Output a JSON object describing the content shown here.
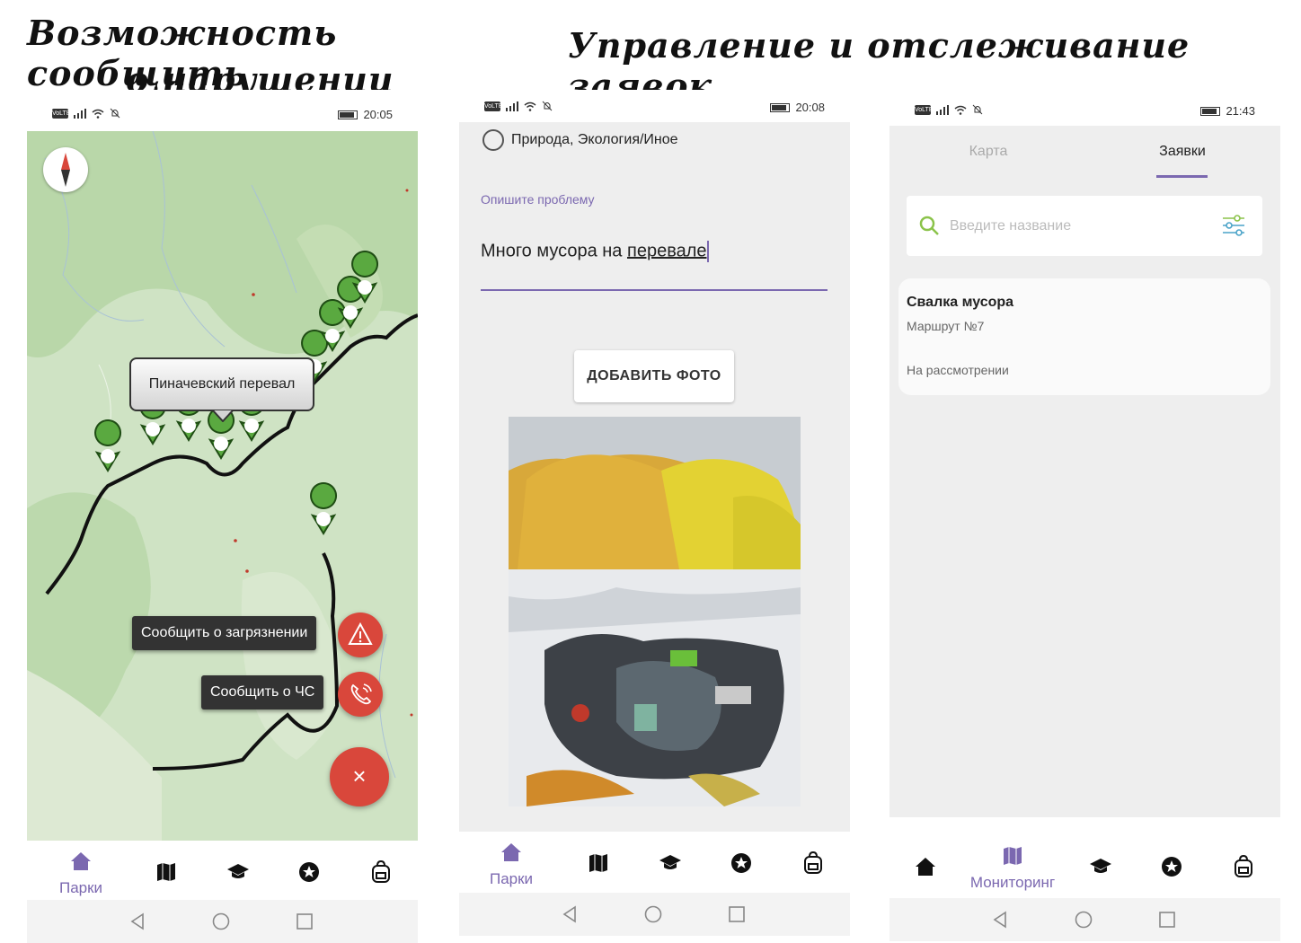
{
  "headings": {
    "report_line1": "Возможность сообщить",
    "report_line2": "о нарушении",
    "manage": "Управление и отслеживание заявок"
  },
  "phones": [
    {
      "time": "20:05"
    },
    {
      "time": "20:08"
    },
    {
      "time": "21:43"
    }
  ],
  "status": {
    "volte": "VoLTE"
  },
  "map_screen": {
    "pass_tooltip": "Пиначевский перевал",
    "report_pollution": "Сообщить о загрязнении",
    "report_emergency": "Сообщить о ЧС",
    "close_fab": "×"
  },
  "form_screen": {
    "category": "Природа, Экология/Иное",
    "describe_label": "Опишите проблему",
    "description_value_plain": "Много мусора на ",
    "description_value_marked": "перевале",
    "add_photo": "ДОБАВИТЬ ФОТО"
  },
  "monitor_screen": {
    "tabs": [
      "Карта",
      "Заявки"
    ],
    "search_placeholder": "Введите название",
    "request": {
      "title": "Свалка мусора",
      "route": "Маршрут №7",
      "status": "На рассмотрении"
    }
  },
  "nav": {
    "parks": "Парки",
    "monitoring": "Мониторинг"
  },
  "colors": {
    "accent": "#7b68b0",
    "fab_red": "#d9473b",
    "map_green": "#cfe3c4",
    "pin_green": "#5aa940",
    "search_green": "#8bc34a"
  }
}
